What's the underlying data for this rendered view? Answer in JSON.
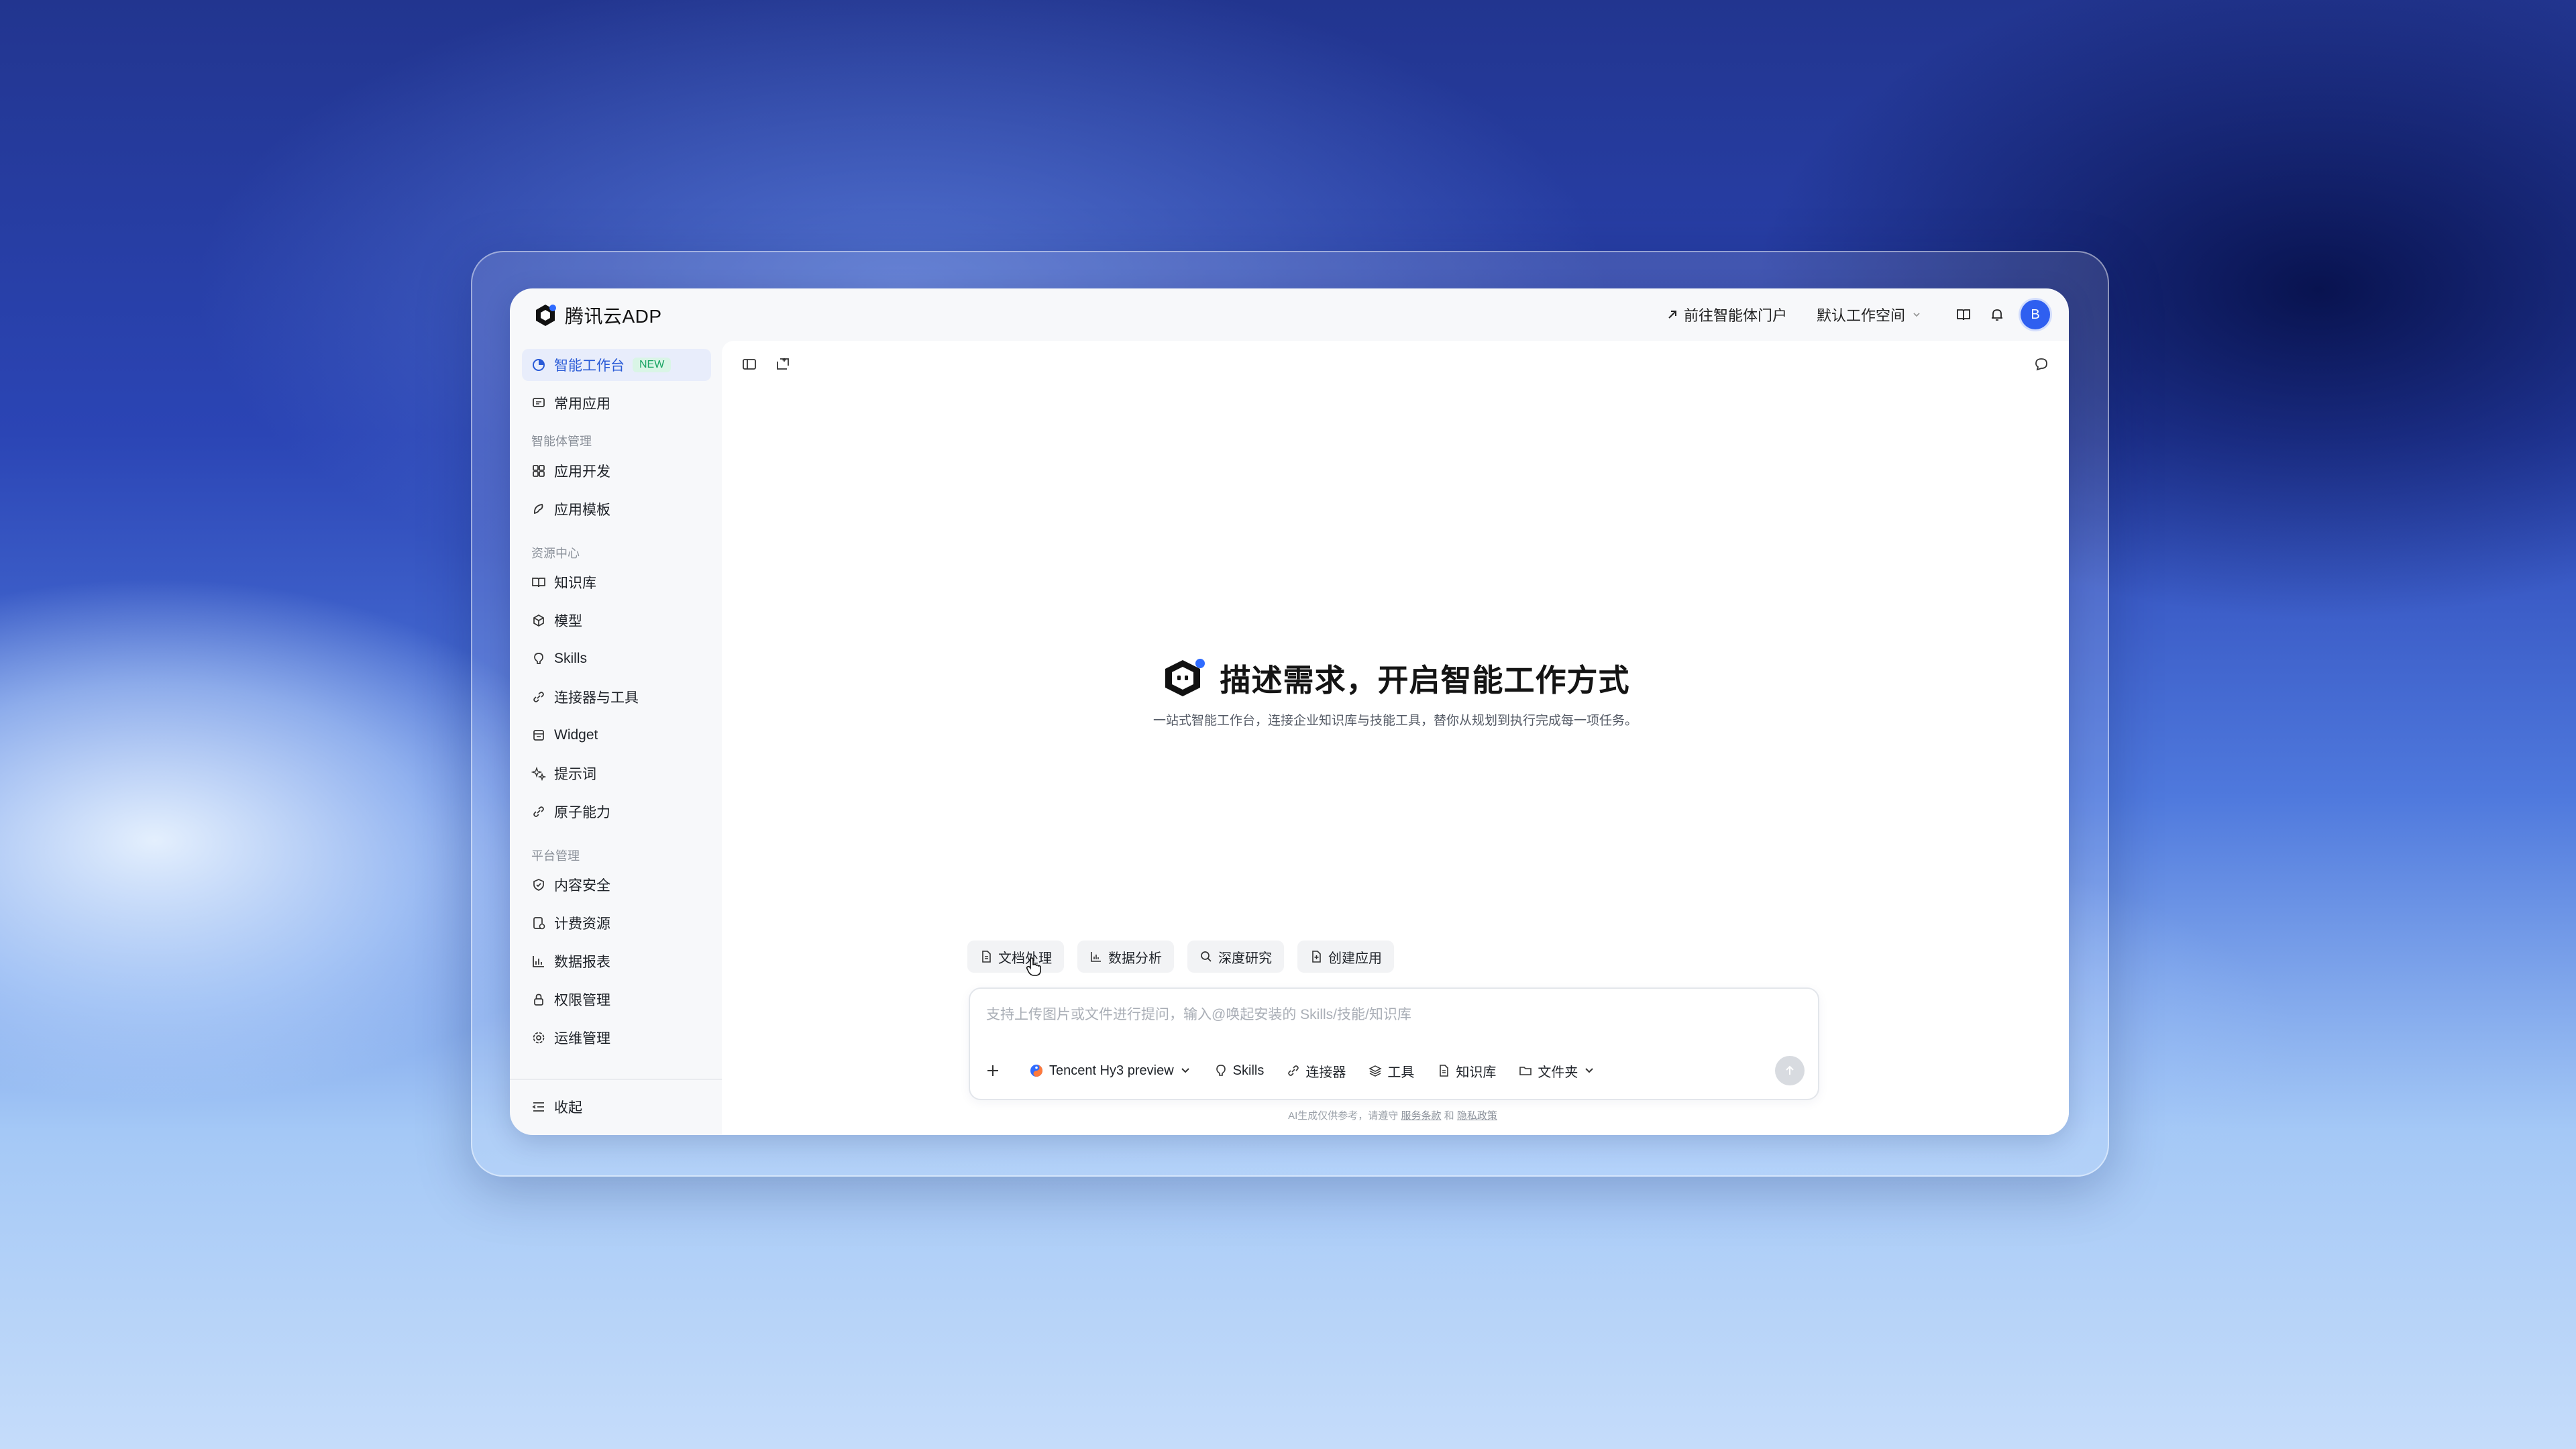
{
  "brand": {
    "logo_text": "腾讯云ADP"
  },
  "header": {
    "portal_link": "前往智能体门户",
    "workspace": "默认工作空间",
    "avatar_letter": "B"
  },
  "sidebar": {
    "top_items": [
      {
        "label": "智能工作台",
        "badge": "NEW",
        "active": true
      },
      {
        "label": "常用应用"
      }
    ],
    "sections": [
      {
        "title": "智能体管理",
        "items": [
          {
            "label": "应用开发"
          },
          {
            "label": "应用模板"
          }
        ]
      },
      {
        "title": "资源中心",
        "items": [
          {
            "label": "知识库"
          },
          {
            "label": "模型"
          },
          {
            "label": "Skills"
          },
          {
            "label": "连接器与工具"
          },
          {
            "label": "Widget"
          },
          {
            "label": "提示词"
          },
          {
            "label": "原子能力"
          }
        ]
      },
      {
        "title": "平台管理",
        "items": [
          {
            "label": "内容安全"
          },
          {
            "label": "计费资源"
          },
          {
            "label": "数据报表"
          },
          {
            "label": "权限管理"
          },
          {
            "label": "运维管理"
          }
        ]
      }
    ],
    "collapse_label": "收起"
  },
  "main": {
    "hero_title": "描述需求，开启智能工作方式",
    "hero_subtitle": "一站式智能工作台，连接企业知识库与技能工具，替你从规划到执行完成每一项任务。",
    "chips": [
      "文档处理",
      "数据分析",
      "深度研究",
      "创建应用"
    ],
    "composer": {
      "placeholder": "支持上传图片或文件进行提问，输入@唤起安装的 Skills/技能/知识库",
      "model": "Tencent Hy3 preview",
      "skills": "Skills",
      "connector": "连接器",
      "tools": "工具",
      "knowledge": "知识库",
      "folder": "文件夹"
    },
    "disclaimer": {
      "prefix": "AI生成仅供参考，请遵守",
      "terms": "服务条款",
      "and": "和",
      "privacy": "隐私政策"
    }
  },
  "colors": {
    "accent": "#2a5bd7",
    "badge_green": "#19a463",
    "avatar": "#2f5ff0"
  }
}
